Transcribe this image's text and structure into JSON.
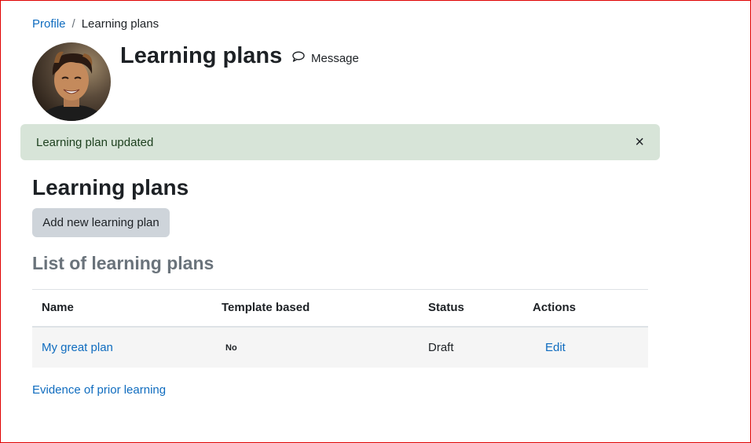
{
  "breadcrumb": {
    "items": [
      {
        "label": "Profile"
      },
      {
        "label": "Learning plans"
      }
    ],
    "separator": "/"
  },
  "header": {
    "title": "Learning plans",
    "message_label": "Message",
    "avatar_alt": "user-avatar"
  },
  "alert": {
    "text": "Learning plan updated",
    "close_symbol": "×",
    "color": "#d7e4d8"
  },
  "main": {
    "heading": "Learning plans",
    "add_button_label": "Add new learning plan",
    "list_heading": "List of learning plans"
  },
  "table": {
    "columns": [
      "Name",
      "Template based",
      "Status",
      "Actions"
    ],
    "rows": [
      {
        "name": "My great plan",
        "template_based": "No",
        "status": "Draft",
        "action": "Edit"
      }
    ]
  },
  "footer_link": "Evidence of prior learning",
  "colors": {
    "link": "#0f6cbf",
    "button_bg": "#ced4da",
    "muted_heading": "#6a737b",
    "frame_border": "#e00000"
  }
}
